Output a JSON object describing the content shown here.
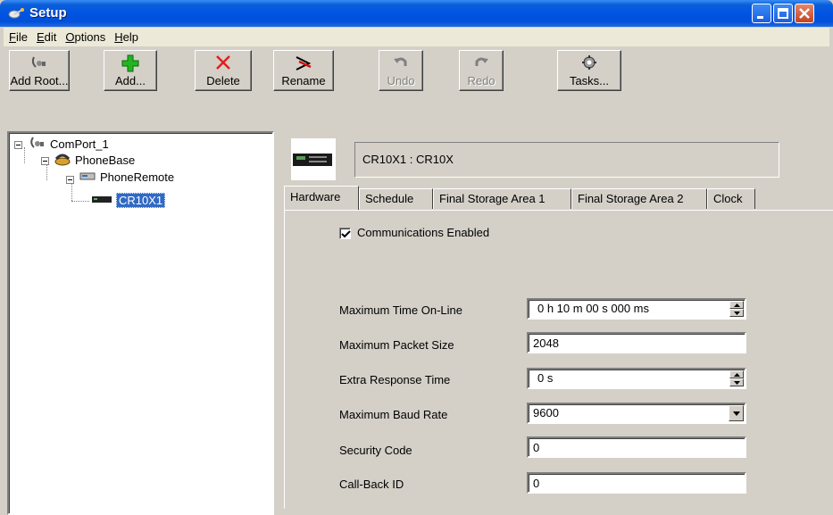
{
  "window": {
    "title": "Setup",
    "icon": "satellite-dish-icon"
  },
  "menu": [
    {
      "label": "File",
      "key": "F",
      "rest": "ile"
    },
    {
      "label": "Edit",
      "key": "E",
      "rest": "dit"
    },
    {
      "label": "Options",
      "key": "O",
      "rest": "ptions"
    },
    {
      "label": "Help",
      "key": "H",
      "rest": "elp"
    }
  ],
  "toolbar": {
    "add_root": "Add Root...",
    "add": "Add...",
    "delete": "Delete",
    "rename": "Rename",
    "undo": "Undo",
    "redo": "Redo",
    "tasks": "Tasks..."
  },
  "tree": {
    "comport": "ComPort_1",
    "phonebase": "PhoneBase",
    "phoneremote": "PhoneRemote",
    "device": "CR10X1"
  },
  "device_header": {
    "name": "CR10X1 : CR10X"
  },
  "tabs": [
    "Hardware",
    "Schedule",
    "Final Storage Area 1",
    "Final Storage Area 2",
    "Clock"
  ],
  "hardware": {
    "communications_enabled_label": "Communications Enabled",
    "communications_enabled": true,
    "max_time_online_label": "Maximum Time On-Line",
    "max_time_online_value": "0 h 10 m 00 s 000 ms",
    "max_packet_size_label": "Maximum Packet Size",
    "max_packet_size_value": "2048",
    "extra_response_time_label": "Extra Response Time",
    "extra_response_time_value": "0 s",
    "max_baud_rate_label": "Maximum Baud Rate",
    "max_baud_rate_value": "9600",
    "security_code_label": "Security Code",
    "security_code_value": "0",
    "callback_id_label": "Call-Back ID",
    "callback_id_value": "0"
  }
}
